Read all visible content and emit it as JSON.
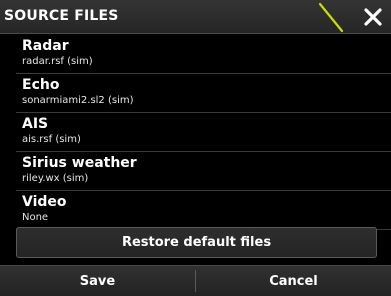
{
  "dialog": {
    "title": "SOURCE FILES",
    "close_icon": "close-icon",
    "accent_color": "#c8e000"
  },
  "sources": [
    {
      "name": "Radar",
      "file": "radar.rsf (sim)"
    },
    {
      "name": "Echo",
      "file": "sonarmiami2.sl2 (sim)"
    },
    {
      "name": "AIS",
      "file": "ais.rsf (sim)"
    },
    {
      "name": "Sirius weather",
      "file": "riley.wx (sim)"
    },
    {
      "name": "Video",
      "file": "None"
    }
  ],
  "restore_label": "Restore default files",
  "footer": {
    "save_label": "Save",
    "cancel_label": "Cancel"
  }
}
